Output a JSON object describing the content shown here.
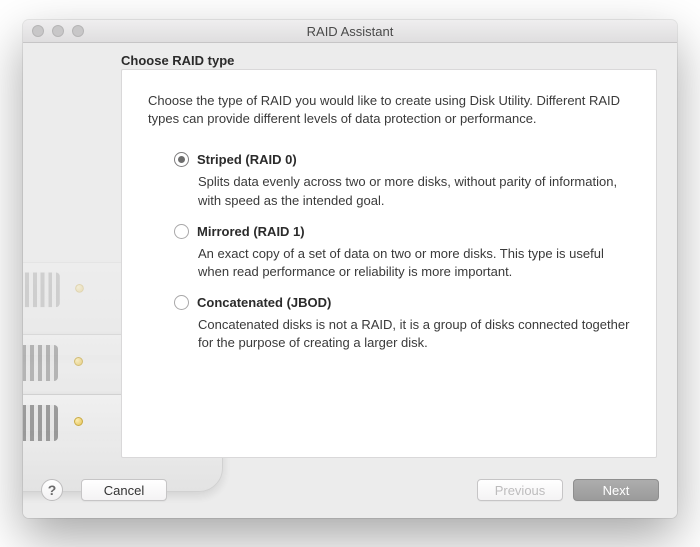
{
  "window": {
    "title": "RAID Assistant"
  },
  "heading": "Choose RAID type",
  "intro": "Choose the type of RAID you would like to create using Disk Utility. Different RAID types can provide different levels of data protection or performance.",
  "options": [
    {
      "label": "Striped (RAID 0)",
      "desc": "Splits data evenly across two or more disks, without parity of information, with speed as the intended goal.",
      "selected": true
    },
    {
      "label": "Mirrored (RAID 1)",
      "desc": "An exact copy of a set of data on two or more disks. This type is useful when read performance or reliability is more important.",
      "selected": false
    },
    {
      "label": "Concatenated (JBOD)",
      "desc": "Concatenated disks is not a RAID, it is a group of disks connected together for the purpose of creating a larger disk.",
      "selected": false
    }
  ],
  "buttons": {
    "help": "?",
    "cancel": "Cancel",
    "previous": "Previous",
    "next": "Next"
  }
}
